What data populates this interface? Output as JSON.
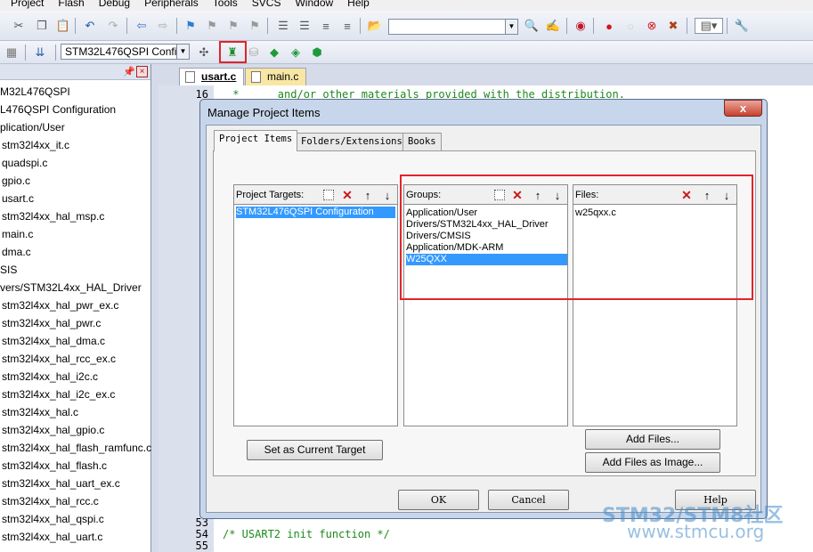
{
  "menu": [
    "Project",
    "Flash",
    "Debug",
    "Peripherals",
    "Tools",
    "SVCS",
    "Window",
    "Help"
  ],
  "toolbar": {
    "target_select": "STM32L476QSPI Configu",
    "search_combo": ""
  },
  "project_tree": [
    "M32L476QSPI",
    "L476QSPI Configuration",
    "plication/User",
    "stm32l4xx_it.c",
    "quadspi.c",
    "gpio.c",
    "usart.c",
    "stm32l4xx_hal_msp.c",
    "main.c",
    "dma.c",
    "SIS",
    "vers/STM32L4xx_HAL_Driver",
    "stm32l4xx_hal_pwr_ex.c",
    "stm32l4xx_hal_pwr.c",
    "stm32l4xx_hal_dma.c",
    "stm32l4xx_hal_rcc_ex.c",
    "stm32l4xx_hal_i2c.c",
    "stm32l4xx_hal_i2c_ex.c",
    "stm32l4xx_hal.c",
    "stm32l4xx_hal_gpio.c",
    "stm32l4xx_hal_flash_ramfunc.c",
    "stm32l4xx_hal_flash.c",
    "stm32l4xx_hal_uart_ex.c",
    "stm32l4xx_hal_rcc.c",
    "stm32l4xx_hal_qspi.c",
    "stm32l4xx_hal_uart.c"
  ],
  "editor": {
    "tabs": [
      "usart.c",
      "main.c"
    ],
    "lines": [
      {
        "num": "16",
        "text": " *      and/or other materials provided with the distribution."
      },
      {
        "num": "53",
        "text": ""
      },
      {
        "num": "54",
        "text": "/* USART2 init function */"
      },
      {
        "num": "55",
        "text": ""
      }
    ]
  },
  "dialog": {
    "title": "Manage Project Items",
    "close": "x",
    "tabs": [
      "Project Items",
      "Folders/Extensions",
      "Books"
    ],
    "targets": {
      "label": "Project Targets:",
      "items": [
        "STM32L476QSPI Configuration"
      ]
    },
    "groups": {
      "label": "Groups:",
      "items": [
        "Application/User",
        "Drivers/STM32L4xx_HAL_Driver",
        "Drivers/CMSIS",
        "Application/MDK-ARM",
        "W25QXX"
      ]
    },
    "files": {
      "label": "Files:",
      "items": [
        "w25qxx.c"
      ]
    },
    "buttons": {
      "set_target": "Set as Current Target",
      "add_files": "Add Files...",
      "add_files_image": "Add Files as Image...",
      "ok": "OK",
      "cancel": "Cancel",
      "help": "Help"
    }
  },
  "watermark": {
    "brand": "STM32/STM8社区",
    "url": "www.stmcu.org"
  },
  "colors": {
    "selection": "#3399ff",
    "highlight_box": "#e0252b",
    "comment": "#1c8a1c"
  }
}
